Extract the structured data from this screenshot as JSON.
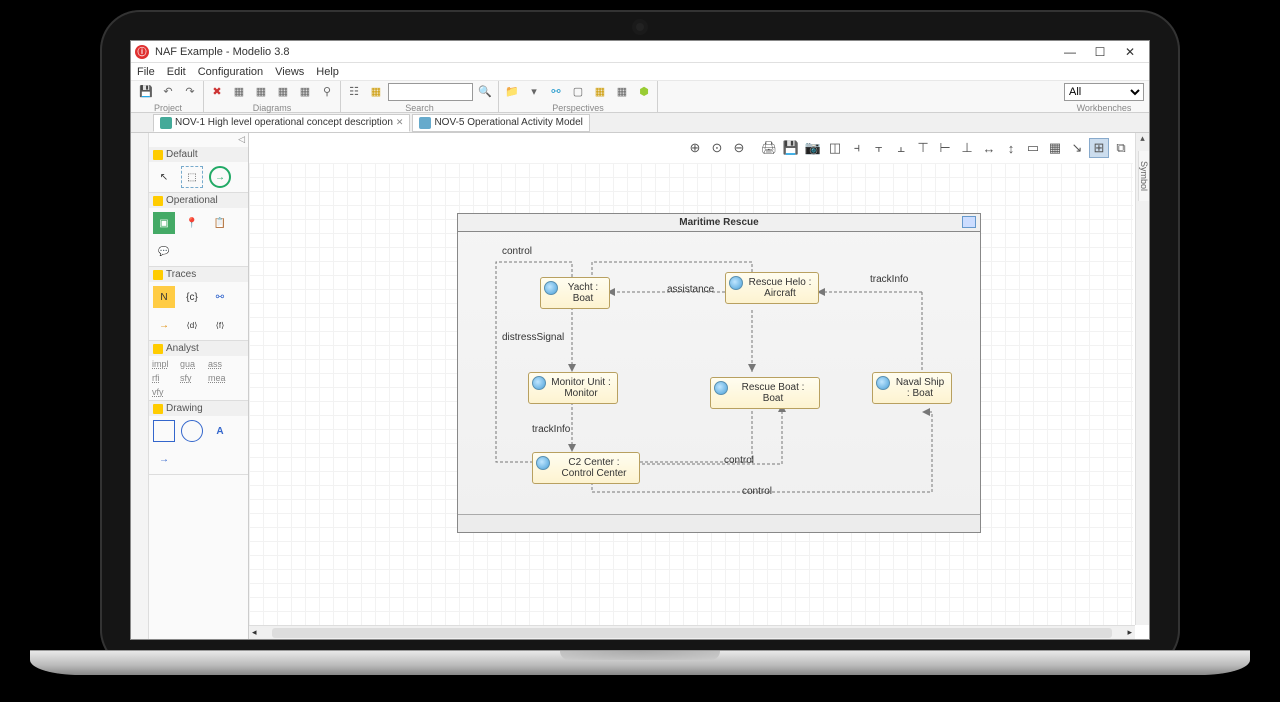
{
  "window": {
    "title": "NAF Example - Modelio 3.8"
  },
  "menu": {
    "items": [
      "File",
      "Edit",
      "Configuration",
      "Views",
      "Help"
    ]
  },
  "toolbar_groups": {
    "project": "Project",
    "diagrams": "Diagrams",
    "search": "Search",
    "perspectives": "Perspectives",
    "workbenches": "Workbenches"
  },
  "workbench_select": "All",
  "tabs": [
    {
      "label": "NOV-1 High level operational concept description",
      "active": true
    },
    {
      "label": "NOV-5 Operational Activity Model",
      "active": false
    }
  ],
  "palette": {
    "sections": {
      "default": "Default",
      "operational": "Operational",
      "traces": "Traces",
      "analyst": "Analyst",
      "drawing": "Drawing"
    },
    "analyst_items": [
      "impl",
      "gua",
      "ass",
      "rfi",
      "sfy",
      "mea",
      "vfy"
    ]
  },
  "symbol_tab": "Symbol",
  "diagram": {
    "title": "Maritime Rescue",
    "nodes": {
      "yacht": "Yacht : Boat",
      "helo": "Rescue Helo : Aircraft",
      "monitor": "Monitor Unit : Monitor",
      "rescue_boat": "Rescue Boat : Boat",
      "naval": "Naval Ship : Boat",
      "c2": "C2 Center : Control Center"
    },
    "labels": {
      "control_top": "control",
      "assistance": "assistance",
      "trackInfo_right": "trackInfo",
      "distressSignal": "distressSignal",
      "trackInfo_left": "trackInfo",
      "control_mid": "control",
      "control_bottom": "control"
    }
  }
}
